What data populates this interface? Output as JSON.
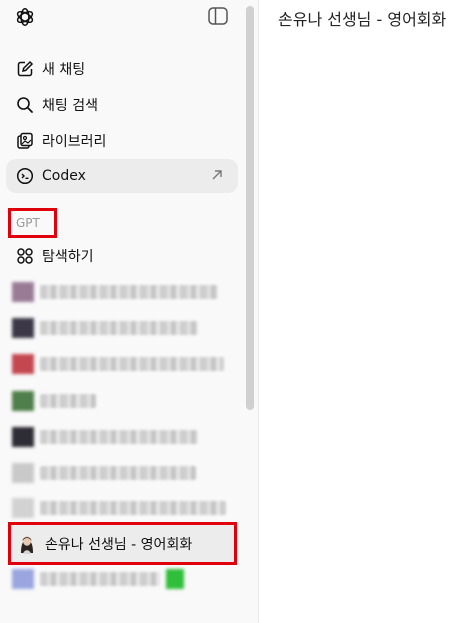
{
  "sidebar": {
    "items": [
      {
        "label": "새 채팅",
        "icon": "edit-icon"
      },
      {
        "label": "채팅 검색",
        "icon": "search-icon"
      },
      {
        "label": "라이브러리",
        "icon": "library-icon"
      },
      {
        "label": "Codex",
        "icon": "codex-icon"
      }
    ],
    "section_label": "GPT",
    "explore_label": "탐색하기",
    "selected_gpt_label": "손유나 선생님 - 영어회화"
  },
  "main": {
    "title": "손유나 선생님 - 영어회화"
  },
  "colors": {
    "highlight_border": "#e0000b",
    "sidebar_bg": "#f9f9f9",
    "selected_bg": "#ececec"
  }
}
